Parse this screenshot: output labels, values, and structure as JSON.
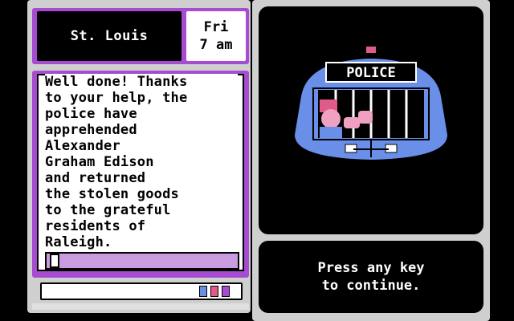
{
  "location": {
    "city": "St. Louis",
    "day": "Fri",
    "time": "7 am"
  },
  "message": {
    "text": "Well done! Thanks\nto your help, the\npolice have\napprehended\nAlexander\nGraham Edison\nand returned\nthe stolen goods\nto the grateful\nresidents of\nRaleigh."
  },
  "scene": {
    "sign": "POLICE",
    "icon": "police-car-with-suspect-icon"
  },
  "prompt": {
    "line1": "Press any key",
    "line2": "to continue."
  },
  "colors": {
    "frame": "#cfcfcf",
    "accent_purple": "#a74bd0",
    "car_blue": "#6a8fe8",
    "sign_bg": "#000000"
  }
}
